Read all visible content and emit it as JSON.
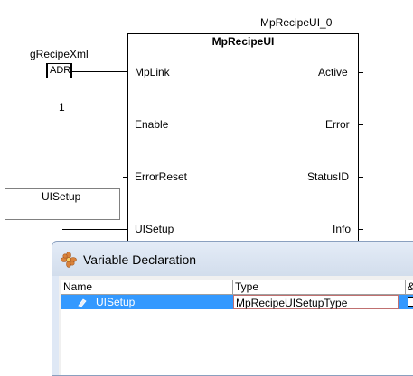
{
  "fb": {
    "instance_name": "MpRecipeUI_0",
    "type_name": "MpRecipeUI",
    "inputs": [
      "MpLink",
      "Enable",
      "ErrorReset",
      "UISetup"
    ],
    "outputs": [
      "Active",
      "Error",
      "StatusID",
      "Info"
    ]
  },
  "wires": {
    "recipe_var": "gRecipeXml",
    "adr_label": "ADR",
    "enable_const": "1",
    "uisetup_var": "UISetup"
  },
  "dialog": {
    "title": "Variable Declaration",
    "columns": [
      "Name",
      "Type",
      "&"
    ],
    "rows": [
      {
        "name": "UISetup",
        "type": "MpRecipeUISetupType"
      }
    ]
  }
}
